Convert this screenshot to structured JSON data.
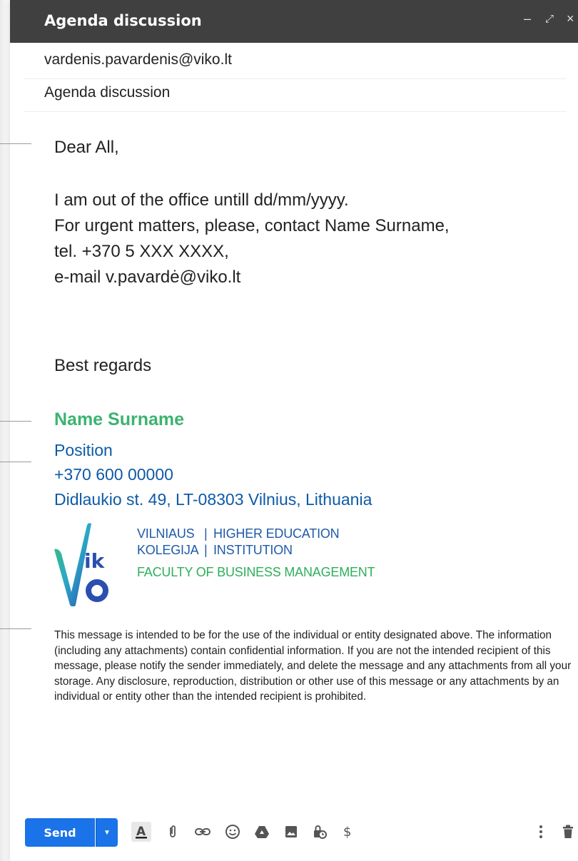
{
  "window": {
    "title": "Agenda discussion",
    "controls": {
      "minimize": "–",
      "expand": "⤢",
      "close": "×"
    }
  },
  "fields": {
    "to": "vardenis.pavardenis@viko.lt",
    "subject": "Agenda discussion"
  },
  "body": {
    "greeting": "Dear All,",
    "lines": [
      "I am out of the office untill dd/mm/yyyy.",
      "For urgent matters, please, contact Name Surname,",
      "tel. +370  5  XXX  XXXX,",
      "e-mail v.pavardė@viko.lt"
    ],
    "closing": "Best regards"
  },
  "signature": {
    "name": "Name Surname",
    "position": "Position",
    "phone": "+370 600 00000",
    "address": "Didlaukio st. 49, LT-08303 Vilnius, Lithuania",
    "name_color": "#3cb371",
    "text_color": "#0e5aa7"
  },
  "logo": {
    "mark": "ik",
    "line1_left": "VILNIAUS",
    "line1_right": "HIGHER EDUCATION",
    "line2_left": "KOLEGIJA",
    "line2_right": "INSTITUTION",
    "line3": "FACULTY OF BUSINESS MANAGEMENT",
    "blue": "#1e5aa8",
    "green": "#2eaf5a"
  },
  "disclaimer": "This message is intended to be for the use of the individual or entity designated above. The information (including any attachments) contain confidential information. If you are not the intended recipient of this message, please notify the sender immediately, and delete the message and any attachments from all your storage. Any disclosure, reproduction, distribution or other use of this message or any attachments by an individual or entity other than the intended recipient is prohibited.",
  "toolbar": {
    "send_label": "Send",
    "send_color": "#1a73e8",
    "icons": [
      "formatting-options-icon",
      "attach-file-icon",
      "insert-link-icon",
      "insert-emoji-icon",
      "google-drive-icon",
      "insert-photo-icon",
      "confidential-mode-icon",
      "insert-money-icon",
      "more-options-icon",
      "discard-draft-icon"
    ]
  }
}
